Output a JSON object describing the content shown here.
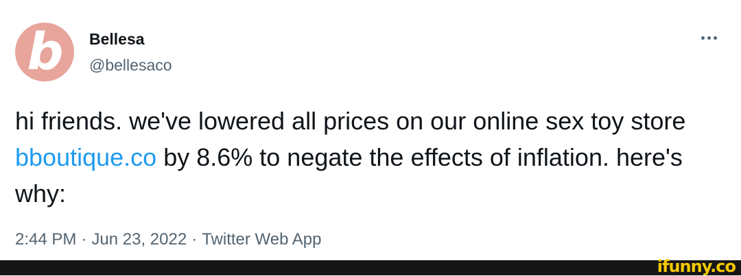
{
  "tweet": {
    "avatar_letter": "b",
    "display_name": "Bellesa",
    "handle": "@bellesaco",
    "text_before_link": "hi friends. we've lowered all prices on our online sex toy store ",
    "link_text": "bboutique.co",
    "text_after_link": " by 8.6% to negate the effects of inflation. here's why:",
    "time": "2:44 PM",
    "separator": "·",
    "date": "Jun 23, 2022",
    "source": "Twitter Web App"
  },
  "watermark": {
    "text": "ifunny.co"
  },
  "colors": {
    "avatar_bg": "#e7a59b",
    "link": "#1d9bf0",
    "secondary_text": "#536471",
    "watermark": "#f5c800",
    "bottom_bar": "#161616"
  },
  "icons": {
    "more": "more-horizontal-icon"
  }
}
